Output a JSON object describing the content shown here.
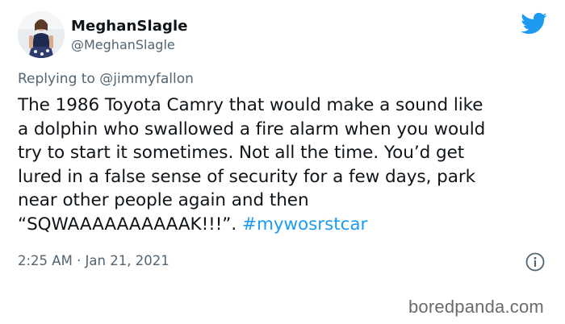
{
  "user": {
    "display_name": "MeghanSlagle",
    "handle": "@MeghanSlagle"
  },
  "reply": {
    "prefix": "Replying to",
    "mention": "@jimmyfallon"
  },
  "tweet": {
    "lines": [
      "The 1986 Toyota Camry that would make a sound like",
      "a dolphin who swallowed a fire alarm when you would",
      "try to start it sometimes. Not all the time. You’d get",
      "lured in a false sense of security for a few days, park",
      "near other people again and then"
    ],
    "last_line_text": "“SQWAAAAAAAAAAK!!!”.",
    "hashtag": "#mywosrstcar"
  },
  "meta": {
    "timestamp": "2:25 AM · Jan 21, 2021"
  },
  "icons": {
    "brand": "twitter-bird-icon",
    "info": "info-icon"
  },
  "colors": {
    "twitter_blue": "#1d9bf0",
    "secondary_text": "#536471",
    "primary_text": "#0f1419"
  },
  "watermark": "boredpanda.com"
}
